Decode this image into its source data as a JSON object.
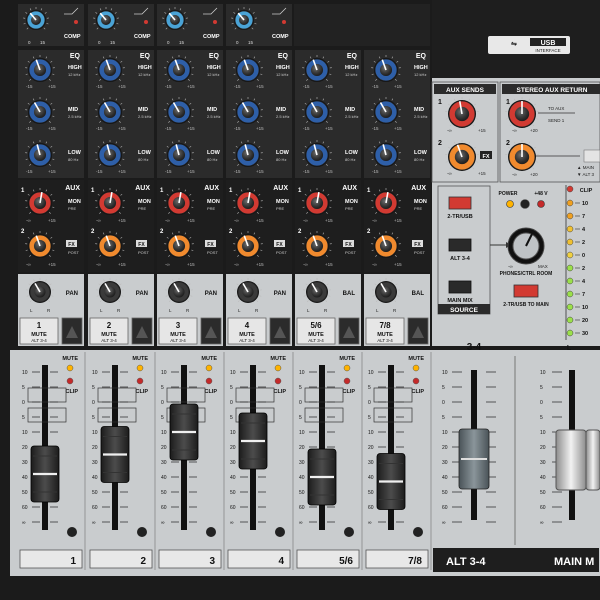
{
  "brand": {
    "usb_label": "USB",
    "usb_sub": "INTERFACE"
  },
  "comp": {
    "label": "COMP",
    "min": "0",
    "max": "15"
  },
  "eq": {
    "title": "EQ",
    "high": "HIGH",
    "high_f": "12 kHz",
    "mid": "MID",
    "mid_f": "2.5 kHz",
    "low": "LOW",
    "low_f": "80 Hz",
    "min": "-15",
    "max": "+15"
  },
  "aux": {
    "title": "AUX",
    "mon": "MON",
    "pre": "PRE",
    "fx": "FX",
    "post": "POST",
    "min": "-∞",
    "max": "+15",
    "n1": "1",
    "n2": "2"
  },
  "pan": {
    "pan": "PAN",
    "bal": "BAL",
    "l": "L",
    "r": "R"
  },
  "channels": [
    {
      "num": "1",
      "mute": "MUTE",
      "alt": "ALT 3-4",
      "fader_label": "1",
      "fader_pos": 0.68,
      "pan_label": "PAN",
      "has_comp": true
    },
    {
      "num": "2",
      "mute": "MUTE",
      "alt": "ALT 3-4",
      "fader_label": "2",
      "fader_pos": 0.55,
      "pan_label": "PAN",
      "has_comp": true
    },
    {
      "num": "3",
      "mute": "MUTE",
      "alt": "ALT 3-4",
      "fader_label": "3",
      "fader_pos": 0.4,
      "pan_label": "PAN",
      "has_comp": true
    },
    {
      "num": "4",
      "mute": "MUTE",
      "alt": "ALT 3-4",
      "fader_label": "4",
      "fader_pos": 0.46,
      "pan_label": "PAN",
      "has_comp": true
    },
    {
      "num": "5/6",
      "mute": "MUTE",
      "alt": "ALT 3-4",
      "fader_label": "5/6",
      "fader_pos": 0.7,
      "pan_label": "BAL",
      "has_comp": false
    },
    {
      "num": "7/8",
      "mute": "MUTE",
      "alt": "ALT 3-4",
      "fader_label": "7/8",
      "fader_pos": 0.73,
      "pan_label": "BAL",
      "has_comp": false
    }
  ],
  "strip": {
    "mute": "MUTE",
    "clip": "CLIP"
  },
  "fader_scale": [
    "10",
    "5",
    "0",
    "5",
    "10",
    "20",
    "30",
    "40",
    "50",
    "60",
    "∞"
  ],
  "aux_sends": {
    "title": "AUX SENDS",
    "n1": "1",
    "n2": "2",
    "fx": "FX",
    "min": "-∞",
    "max": "+15"
  },
  "stereo_aux_returns": {
    "title": "STEREO AUX RETURN",
    "to_aux": "TO AUX",
    "send1": "SEND 1",
    "main": "▲ MAIN",
    "alt": "▼ ALT 3",
    "min": "-∞",
    "max": "+20"
  },
  "source": {
    "power": "POWER",
    "phantom": "+48 V",
    "btn1": "2-TR/USB",
    "btn2": "ALT 3-4",
    "btn3": "MAIN MIX",
    "title": "SOURCE",
    "phones": "PHONES/CTRL ROOM",
    "min": "-∞",
    "max": "MAX",
    "to_main": "2-TR/USB TO MAIN"
  },
  "meter": {
    "clip": "CLIP",
    "labels": [
      "10",
      "7",
      "4",
      "2",
      "0",
      "2",
      "4",
      "7",
      "10",
      "20",
      "30"
    ],
    "l": "L"
  },
  "alt_fader": {
    "top": "3-4",
    "label": "ALT 3-4",
    "pos": 0.58
  },
  "main_fader": {
    "label": "MAIN M"
  },
  "colors": {
    "panel_dark": "#2b2b2b",
    "panel_light": "#c9ccce",
    "knob_blue": "#2e5fa8",
    "knob_red": "#d23a32",
    "knob_orange": "#f08a2e",
    "knob_cyan": "#4aa3d6",
    "knob_gray": "#3a3a3a"
  }
}
